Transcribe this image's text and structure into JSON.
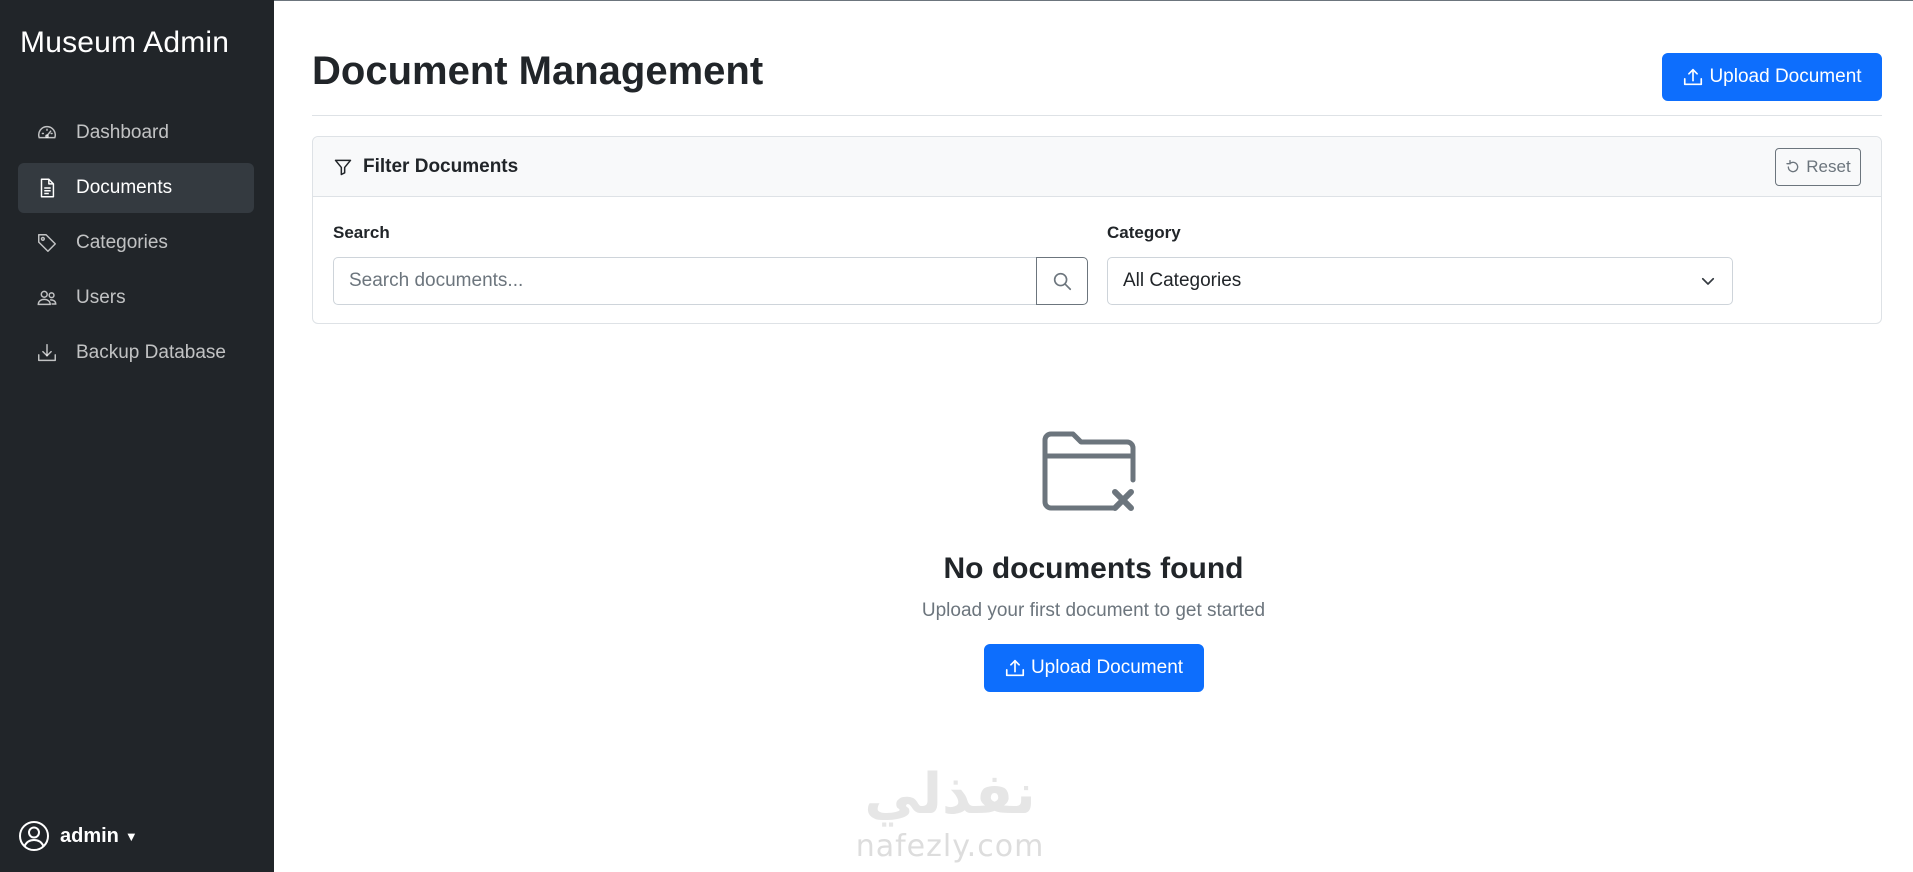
{
  "sidebar": {
    "brand": "Museum Admin",
    "items": [
      {
        "label": "Dashboard",
        "icon": "speedometer-icon",
        "active": false
      },
      {
        "label": "Documents",
        "icon": "file-text-icon",
        "active": true
      },
      {
        "label": "Categories",
        "icon": "tags-icon",
        "active": false
      },
      {
        "label": "Users",
        "icon": "people-icon",
        "active": false
      },
      {
        "label": "Backup Database",
        "icon": "download-icon",
        "active": false
      }
    ],
    "user": {
      "name": "admin",
      "icon": "person-circle-icon"
    }
  },
  "header": {
    "title": "Document Management",
    "upload_label": "Upload Document"
  },
  "filter": {
    "title": "Filter Documents",
    "reset_label": "Reset",
    "search_label": "Search",
    "search_placeholder": "Search documents...",
    "search_value": "",
    "category_label": "Category",
    "category_selected": "All Categories"
  },
  "empty": {
    "title": "No documents found",
    "subtitle": "Upload your first document to get started",
    "upload_label": "Upload Document",
    "icon": "folder-x-icon"
  },
  "watermark": {
    "arabic": "نفذلي",
    "latin": "nafezly.com"
  },
  "colors": {
    "sidebar_bg": "#212529",
    "primary": "#0d6efd",
    "active_item_bg": "#343a40",
    "muted": "#6c757d"
  }
}
